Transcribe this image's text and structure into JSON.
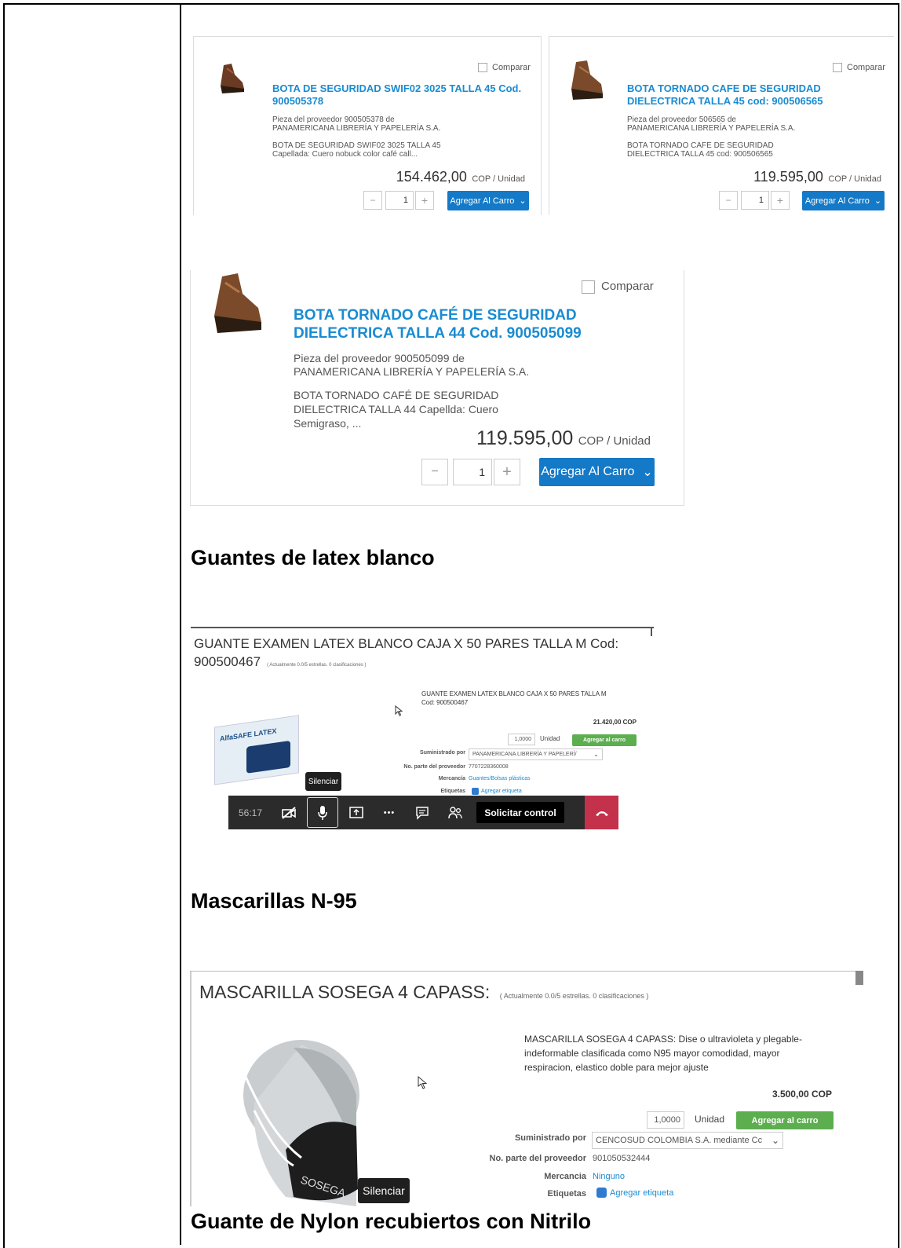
{
  "product_cards_top": [
    {
      "compare_label": "Comparar",
      "title": "BOTA DE SEGURIDAD SWIF02 3025 TALLA 45 Cod. 900505378",
      "supplier_line1": "Pieza del proveedor 900505378 de",
      "supplier_line2": "PANAMERICANA LIBRERÍA Y PAPELERÍA S.A.",
      "desc_line1": "BOTA DE SEGURIDAD SWIF02 3025 TALLA 45",
      "desc_line2": "Capellada: Cuero nobuck color café call...",
      "price": "154.462,00",
      "price_unit": "COP / Unidad",
      "qty": "1",
      "minus": "−",
      "plus": "+",
      "add_button": "Agregar Al Carro",
      "caret": "⌄"
    },
    {
      "compare_label": "Comparar",
      "title": "BOTA TORNADO CAFE DE SEGURIDAD DIELECTRICA TALLA 45 cod: 900506565",
      "supplier_line1": "Pieza del proveedor 506565 de",
      "supplier_line2": "PANAMERICANA LIBRERÍA Y PAPELERÍA S.A.",
      "desc_line1": "BOTA TORNADO CAFE DE SEGURIDAD",
      "desc_line2": "DIELECTRICA TALLA 45 cod: 900506565",
      "price": "119.595,00",
      "price_unit": "COP / Unidad",
      "qty": "1",
      "minus": "−",
      "plus": "+",
      "add_button": "Agregar Al Carro",
      "caret": "⌄"
    }
  ],
  "product_card_large": {
    "compare_label": "Comparar",
    "title_line1": "BOTA TORNADO CAFÉ DE SEGURIDAD",
    "title_line2": "DIELECTRICA TALLA 44 Cod. 900505099",
    "supplier_line1": "Pieza del proveedor 900505099 de",
    "supplier_line2": "PANAMERICANA LIBRERÍA Y PAPELERÍA S.A.",
    "desc_line1": "BOTA TORNADO CAFÉ DE SEGURIDAD",
    "desc_line2": "DIELECTRICA TALLA 44 Capellda: Cuero",
    "desc_line3": "Semigraso, ...",
    "price": "119.595,00",
    "price_unit": "COP / Unidad",
    "qty": "1",
    "minus": "−",
    "plus": "+",
    "add_button": "Agregar Al Carro",
    "caret": "⌄"
  },
  "headings": {
    "gloves": "Guantes de latex blanco",
    "masks": "Mascarillas N-95",
    "nylon": "Guante de Nylon recubiertos con Nitrilo"
  },
  "glove_product": {
    "title_line1": "GUANTE EXAMEN LATEX BLANCO CAJA X 50 PARES TALLA M Cod:",
    "title_line2": "900500467",
    "rating": "( Actualmente 0.0/5 estrellas. 0 clasificaciones )",
    "desc_line1": "GUANTE EXAMEN LATEX BLANCO CAJA X 50 PARES TALLA M",
    "desc_line2": "Cod: 900500467",
    "price": "21.420,00 COP",
    "qty": "1,0000",
    "unit": "Unidad",
    "add_button": "Agregar al carro",
    "supplied_label": "Suministrado por",
    "supplied_value": "PANAMERICANA LIBRERÍA Y PAPELERÍ/",
    "part_label": "No. parte del proveedor",
    "part_value": "7707228360008",
    "merch_label": "Mercancía",
    "merch_value": "Guantes/Bolsas plásticas",
    "tags_label": "Etiquetas",
    "tags_value": "Agregar etiqueta",
    "box_brand": "AlfaSAFE LATEX"
  },
  "meeting_toolbar": {
    "timer": "56:17",
    "tooltip": "Silenciar",
    "control_button": "Solicitar control",
    "more": "•••"
  },
  "mask_product": {
    "title": "MASCARILLA SOSEGA 4 CAPASS:",
    "rating": "( Actualmente 0.0/5 estrellas. 0 clasificaciones )",
    "desc_line1": "MASCARILLA SOSEGA 4 CAPASS: Dise o ultravioleta y plegable-",
    "desc_line2": "indeformable clasificada como N95 mayor comodidad, mayor",
    "desc_line3": "respiracion, elastico doble para mejor ajuste",
    "price": "3.500,00 COP",
    "qty": "1,0000",
    "unit": "Unidad",
    "add_button": "Agregar al carro",
    "supplied_label": "Suministrado por",
    "supplied_value": "CENCOSUD COLOMBIA S.A. mediante Cc",
    "part_label": "No. parte del proveedor",
    "part_value": "901050532444",
    "merch_label": "Mercancia",
    "merch_value": "Ninguno",
    "tags_label": "Etiquetas",
    "tags_value": "Agregar etiqueta",
    "tooltip": "Silenciar",
    "mask_brand": "SOSEGA"
  },
  "colors": {
    "link_blue": "#1a8bd1",
    "button_blue": "#1479c7",
    "button_green": "#5cae4f",
    "hangup_red": "#c4314b"
  }
}
